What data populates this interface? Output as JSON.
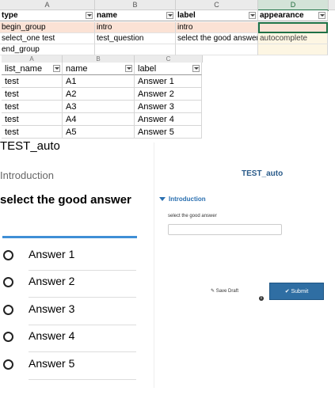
{
  "sheet1": {
    "columns": [
      "A",
      "B",
      "C",
      "D"
    ],
    "headers": [
      "type",
      "name",
      "label",
      "appearance"
    ],
    "rows": [
      [
        "begin_group",
        "intro",
        "intro",
        ""
      ],
      [
        "select_one test",
        "test_question",
        "select the good answer",
        "autocomplete"
      ],
      [
        "end_group",
        "",
        "",
        ""
      ]
    ]
  },
  "sheet2": {
    "columns": [
      "A",
      "B",
      "C"
    ],
    "headers": [
      "list_name",
      "name",
      "label"
    ],
    "rows": [
      [
        "test",
        "A1",
        "Answer 1"
      ],
      [
        "test",
        "A2",
        "Answer 2"
      ],
      [
        "test",
        "A3",
        "Answer 3"
      ],
      [
        "test",
        "A4",
        "Answer 4"
      ],
      [
        "test",
        "A5",
        "Answer 5"
      ]
    ]
  },
  "form_left": {
    "title": "TEST_auto",
    "section": "Introduction",
    "question": "select the good answer",
    "options": [
      "Answer 1",
      "Answer 2",
      "Answer 3",
      "Answer 4",
      "Answer 5"
    ]
  },
  "form_right": {
    "title": "TEST_auto",
    "section": "Introduction",
    "question": "select the good answer",
    "save_draft": "✎ Save Draft",
    "info_icon": "i",
    "submit": "✔ Submit"
  }
}
